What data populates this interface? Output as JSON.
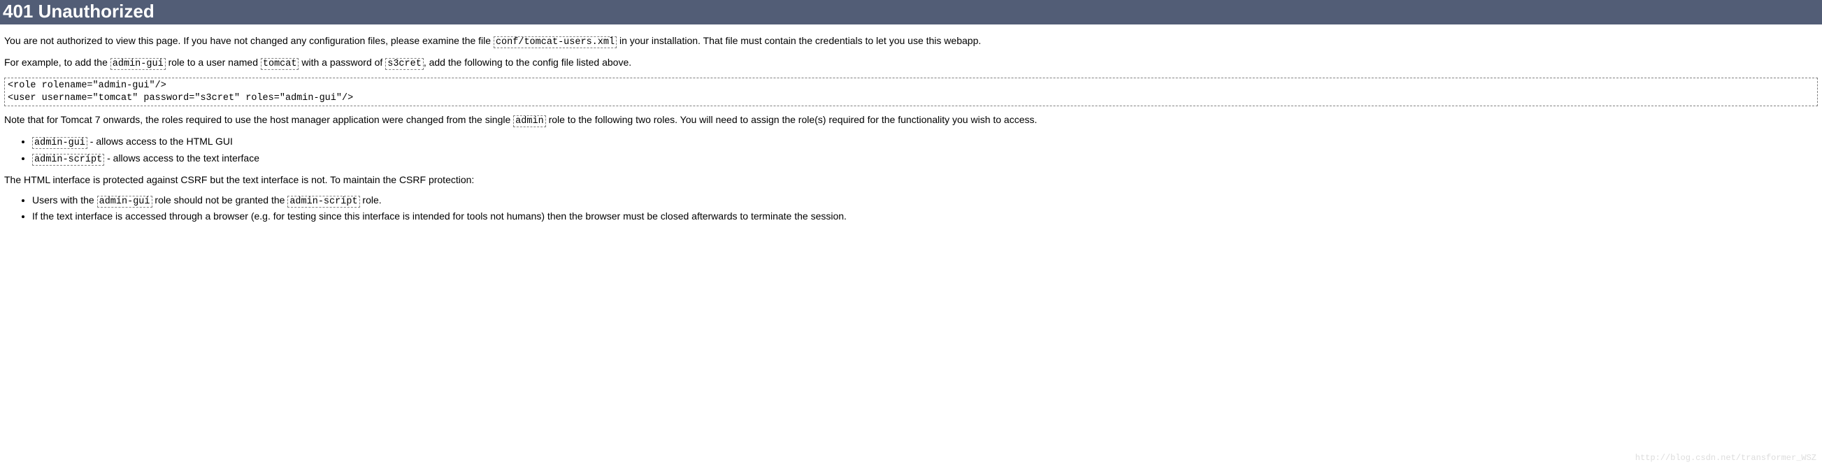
{
  "header": {
    "title": "401 Unauthorized"
  },
  "p1": {
    "t1": "You are not authorized to view this page. If you have not changed any configuration files, please examine the file ",
    "c1": "conf/tomcat-users.xml",
    "t2": " in your installation. That file must contain the credentials to let you use this webapp."
  },
  "p2": {
    "t1": "For example, to add the ",
    "c1": "admin-gui",
    "t2": " role to a user named ",
    "c2": "tomcat",
    "t3": " with a password of ",
    "c3": "s3cret",
    "t4": ", add the following to the config file listed above."
  },
  "codeblock": "<role rolename=\"admin-gui\"/>\n<user username=\"tomcat\" password=\"s3cret\" roles=\"admin-gui\"/>",
  "p3": {
    "t1": "Note that for Tomcat 7 onwards, the roles required to use the host manager application were changed from the single ",
    "c1": "admin",
    "t2": " role to the following two roles. You will need to assign the role(s) required for the functionality you wish to access."
  },
  "roles_list": {
    "item1": {
      "code": "admin-gui",
      "text": " - allows access to the HTML GUI"
    },
    "item2": {
      "code": "admin-script",
      "text": " - allows access to the text interface"
    }
  },
  "p4": {
    "t1": "The HTML interface is protected against CSRF but the text interface is not. To maintain the CSRF protection:"
  },
  "csrf_list": {
    "item1": {
      "t1": "Users with the ",
      "c1": "admin-gui",
      "t2": " role should not be granted the ",
      "c2": "admin-script",
      "t3": " role."
    },
    "item2": {
      "t1": "If the text interface is accessed through a browser (e.g. for testing since this interface is intended for tools not humans) then the browser must be closed afterwards to terminate the session."
    }
  },
  "watermark": "http://blog.csdn.net/transformer_WSZ"
}
